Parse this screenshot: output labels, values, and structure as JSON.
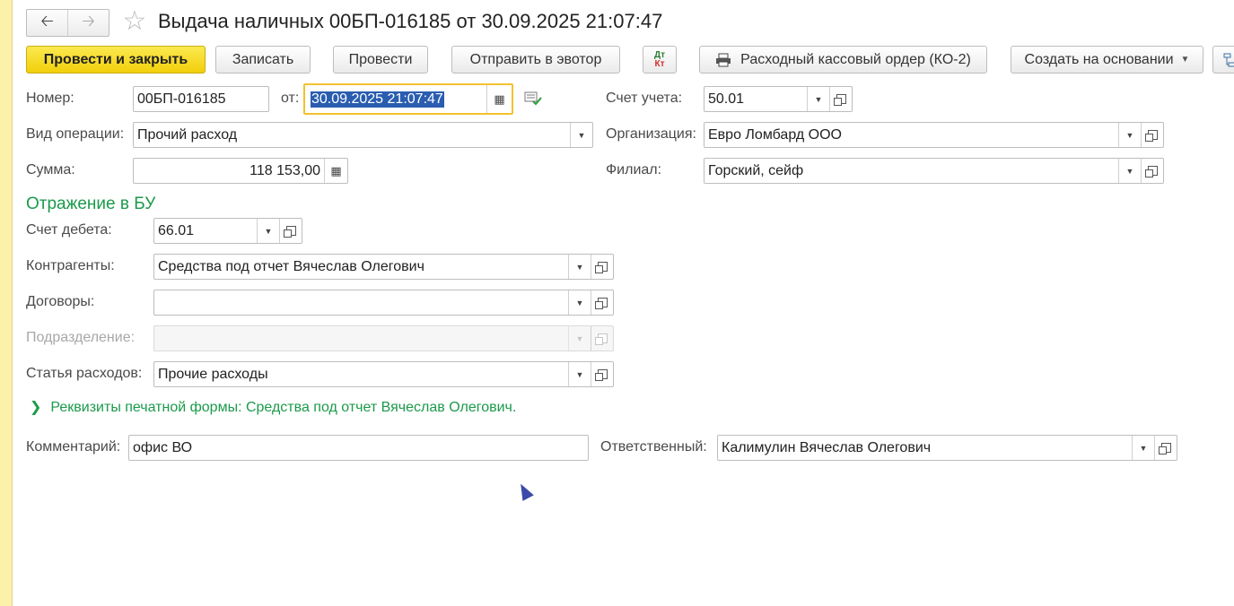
{
  "header": {
    "back_icon": "arrow-left-icon",
    "forward_icon": "arrow-right-icon",
    "favorite_icon": "star-icon",
    "title": "Выдача наличных 00БП-016185 от 30.09.2025 21:07:47"
  },
  "toolbar": {
    "post_close": "Провести и закрыть",
    "save": "Записать",
    "post": "Провести",
    "send_evotor": "Отправить в эвотор",
    "dt_label": "Дт",
    "kt_label": "Кт",
    "print_order": "Расходный кассовый ордер (КО-2)",
    "create_based": "Создать на основании"
  },
  "form": {
    "number_label": "Номер:",
    "number_value": "00БП-016185",
    "date_label": "от:",
    "date_value": "30.09.2025 21:07:47",
    "account_label": "Счет учета:",
    "account_value": "50.01",
    "operation_label": "Вид операции:",
    "operation_value": "Прочий расход",
    "org_label": "Организация:",
    "org_value": "Евро Ломбард ООО",
    "sum_label": "Сумма:",
    "sum_value": "118 153,00",
    "branch_label": "Филиал:",
    "branch_value": "Горский, сейф"
  },
  "bu": {
    "section_title": "Отражение в БУ",
    "debit_label": "Счет дебета:",
    "debit_value": "66.01",
    "contractors_label": "Контрагенты:",
    "contractors_value": "Средства под отчет Вячеслав Олегович",
    "contracts_label": "Договоры:",
    "contracts_value": "",
    "division_label": "Подразделение:",
    "division_value": "",
    "expense_label": "Статья расходов:",
    "expense_value": "Прочие расходы"
  },
  "print_requisites": "Реквизиты печатной формы: Средства под отчет Вячеслав Олегович.",
  "footer": {
    "comment_label": "Комментарий:",
    "comment_value": "офис ВО",
    "responsible_label": "Ответственный:",
    "responsible_value": "Калимулин Вячеслав Олегович"
  }
}
